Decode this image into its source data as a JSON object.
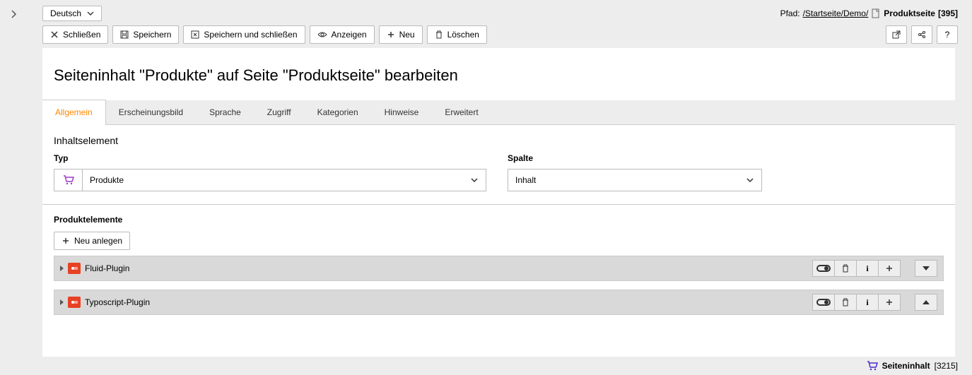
{
  "topbar": {
    "language": "Deutsch",
    "path_label": "Pfad:",
    "path_segments": "/Startseite/Demo/",
    "page_name": "Produktseite",
    "page_id": "[395]"
  },
  "actions": {
    "close": "Schließen",
    "save": "Speichern",
    "save_close": "Speichern und schließen",
    "view": "Anzeigen",
    "new": "Neu",
    "delete": "Löschen",
    "help": "?"
  },
  "heading": "Seiteninhalt \"Produkte\" auf Seite \"Produktseite\" bearbeiten",
  "tabs": [
    "Allgemein",
    "Erscheinungsbild",
    "Sprache",
    "Zugriff",
    "Kategorien",
    "Hinweise",
    "Erweitert"
  ],
  "section": {
    "title": "Inhaltselement",
    "type_label": "Typ",
    "type_value": "Produkte",
    "column_label": "Spalte",
    "column_value": "Inhalt"
  },
  "products": {
    "title": "Produktelemente",
    "new_button": "Neu anlegen",
    "items": [
      {
        "name": "Fluid-Plugin"
      },
      {
        "name": "Typoscript-Plugin"
      }
    ]
  },
  "footer": {
    "label": "Seiteninhalt",
    "id": "[3215]"
  }
}
